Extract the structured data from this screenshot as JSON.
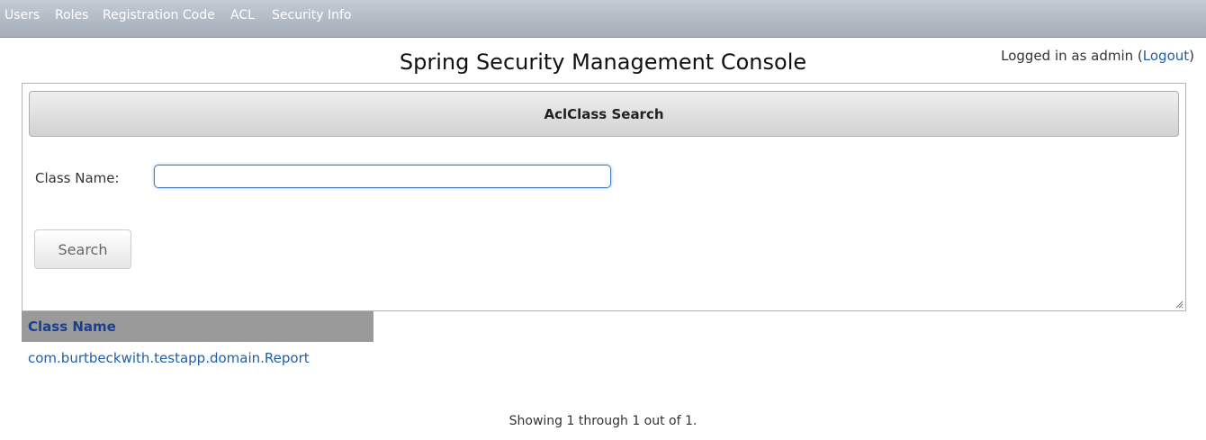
{
  "menu": {
    "items": [
      "Users",
      "Roles",
      "Registration Code",
      "ACL",
      "Security Info"
    ]
  },
  "header": {
    "title": "Spring Security Management Console",
    "login_prefix": "Logged in as admin (",
    "logout_label": "Logout",
    "login_suffix": ")"
  },
  "search": {
    "panel_title": "AclClass Search",
    "class_name_label": "Class Name:",
    "class_name_value": "",
    "search_button_label": "Search"
  },
  "results": {
    "column_header": "Class Name",
    "rows": [
      "com.burtbeckwith.testapp.domain.Report"
    ],
    "paging_text": "Showing 1 through 1 out of 1."
  },
  "colors": {
    "menubar": "#a4adb8",
    "link": "#1f5fa8",
    "table_header": "#9a9a9a",
    "input_focus": "#4a7fc0"
  }
}
